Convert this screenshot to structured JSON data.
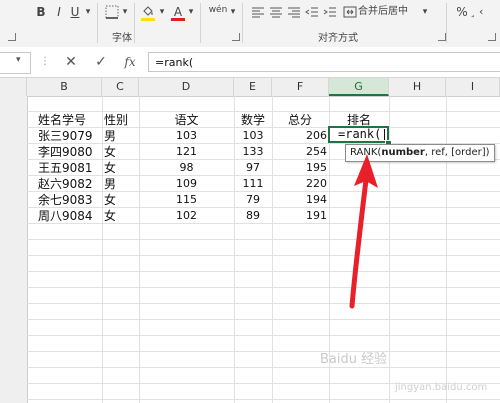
{
  "ribbon": {
    "bold": "B",
    "italic": "I",
    "underline": "U",
    "underline_dd": "▾",
    "fill_dd": "▾",
    "fontcolor_dd": "▾",
    "font_color_letter": "A",
    "phonetic": "wén",
    "merge_label": "合并后居中",
    "merge_dd": "▾",
    "percent": "%",
    "font_group": "字体",
    "align_group": "对齐方式",
    "accent_red": "#e02020",
    "accent_yellow": "#ffe000"
  },
  "formula_bar": {
    "namebox_dd": "▾",
    "cancel": "✕",
    "enter": "✓",
    "fx": "fx",
    "formula": "=rank("
  },
  "columns": [
    "B",
    "C",
    "D",
    "E",
    "F",
    "G",
    "H",
    "I"
  ],
  "table": {
    "headers": [
      "姓名学号",
      "性别",
      "语文",
      "数学",
      "总分",
      "排名"
    ],
    "rows": [
      [
        "张三9079",
        "男",
        "103",
        "103",
        "206"
      ],
      [
        "李四9080",
        "女",
        "121",
        "133",
        "254"
      ],
      [
        "王五9081",
        "女",
        "98",
        "97",
        "195"
      ],
      [
        "赵六9082",
        "男",
        "109",
        "111",
        "220"
      ],
      [
        "余七9083",
        "女",
        "115",
        "79",
        "194"
      ],
      [
        "周八9084",
        "女",
        "102",
        "89",
        "191"
      ]
    ]
  },
  "active_cell": {
    "text": "=rank("
  },
  "tooltip": {
    "func": "RANK(",
    "param": "number",
    "rest": ", ref, [order])"
  },
  "watermark": {
    "text": "Baidu 经验",
    "sub": "jingyan.baidu.com"
  }
}
